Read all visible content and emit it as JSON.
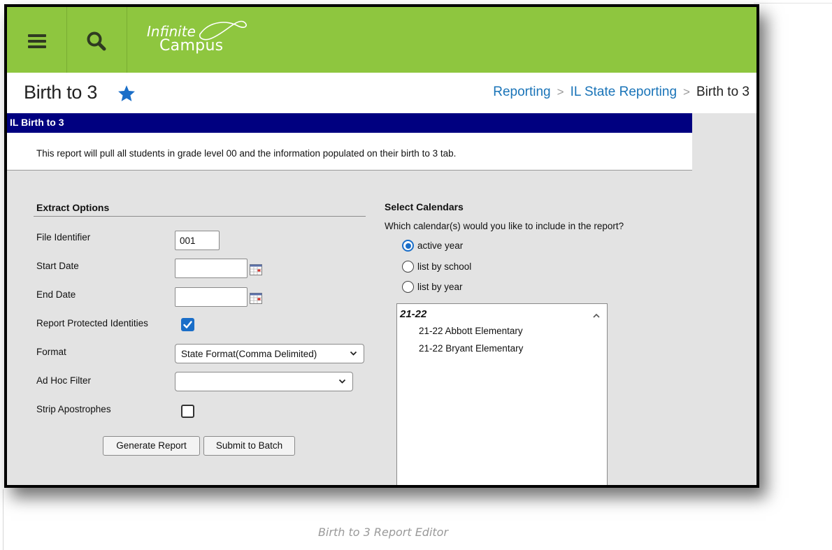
{
  "app": {
    "logo_top": "Infinite",
    "logo_bottom": "Campus",
    "brand_color": "#8ec63f",
    "icons": [
      "menu-icon",
      "search-icon",
      "star-icon",
      "calendar-icon",
      "checkmark-icon",
      "chevron-down-icon",
      "chevron-up-icon"
    ]
  },
  "header": {
    "title": "Birth to 3",
    "breadcrumb": [
      "Reporting",
      "IL State Reporting",
      "Birth to 3"
    ]
  },
  "report": {
    "header": "IL Birth to 3",
    "description": "This report will pull all students in grade level 00 and the information populated on their birth to 3 tab."
  },
  "extract": {
    "section_title": "Extract Options",
    "file_identifier_label": "File Identifier",
    "file_identifier_value": "001",
    "start_date_label": "Start Date",
    "start_date_value": "",
    "end_date_label": "End Date",
    "end_date_value": "",
    "protected_label": "Report Protected Identities",
    "protected_checked": true,
    "format_label": "Format",
    "format_value": "State Format(Comma Delimited)",
    "adhoc_label": "Ad Hoc Filter",
    "adhoc_value": "",
    "strip_label": "Strip Apostrophes",
    "strip_checked": false,
    "generate_button": "Generate Report",
    "batch_button": "Submit to Batch"
  },
  "calendars": {
    "section_title": "Select Calendars",
    "question": "Which calendar(s) would you like to include in the report?",
    "options": [
      {
        "label": "active year",
        "selected": true
      },
      {
        "label": "list by school",
        "selected": false
      },
      {
        "label": "list by year",
        "selected": false
      }
    ],
    "group": "21-22",
    "items": [
      "21-22 Abbott Elementary",
      "21-22 Bryant Elementary"
    ]
  },
  "caption": "Birth to 3 Report Editor"
}
